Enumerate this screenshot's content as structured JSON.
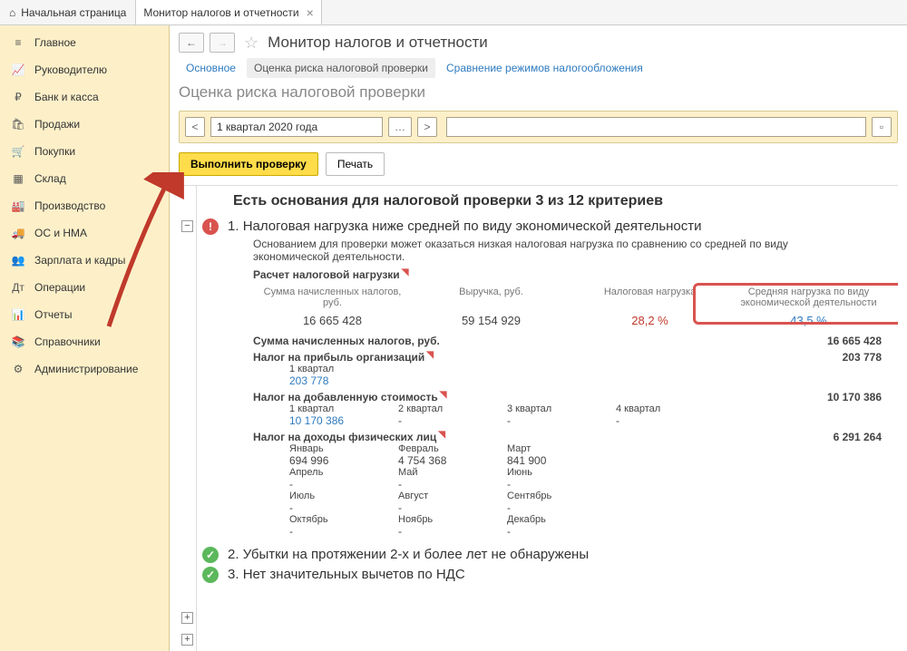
{
  "topbar": {
    "home": "Начальная страница",
    "tab": "Монитор налогов и отчетности"
  },
  "sidebar": {
    "items": [
      "Главное",
      "Руководителю",
      "Банк и касса",
      "Продажи",
      "Покупки",
      "Склад",
      "Производство",
      "ОС и НМА",
      "Зарплата и кадры",
      "Операции",
      "Отчеты",
      "Справочники",
      "Администрирование"
    ]
  },
  "header": {
    "title": "Монитор налогов и отчетности",
    "subtabs": [
      "Основное",
      "Оценка риска налоговой проверки",
      "Сравнение режимов налогообложения"
    ],
    "section": "Оценка риска налоговой проверки"
  },
  "toolbar": {
    "period": "1 квартал 2020 года",
    "run": "Выполнить проверку",
    "print": "Печать"
  },
  "report": {
    "heading": "Есть основания для налоговой проверки 3 из 12 критериев",
    "crit1": {
      "num": "1.",
      "title": "Налоговая нагрузка ниже средней по виду экономической деятельности",
      "desc": "Основанием для проверки может оказаться низкая налоговая нагрузка по сравнению со средней по виду экономической деятельности.",
      "calc_head": "Расчет налоговой нагрузки",
      "cols": [
        "Сумма начисленных налогов, руб.",
        "Выручка, руб.",
        "Налоговая нагрузка",
        "Средняя нагрузка по виду экономической деятельности"
      ],
      "vals": [
        "16 665 428",
        "59 154 929",
        "28,2 %",
        "43,5 %"
      ],
      "sum_label": "Сумма начисленных налогов, руб.",
      "sum_val": "16 665 428",
      "profit_tax": "Налог на прибыль организаций",
      "profit_val": "203 778",
      "q1": "1 квартал",
      "q1v": "203 778",
      "vat": "Налог на добавленную стоимость",
      "vat_val": "10 170 386",
      "quarters": [
        "1 квартал",
        "2 квартал",
        "3 квартал",
        "4 квартал"
      ],
      "vat_qv": [
        "10 170 386",
        "-",
        "-",
        "-"
      ],
      "pit": "Налог на доходы физических лиц",
      "pit_val": "6 291 264",
      "months1": [
        "Январь",
        "Февраль",
        "Март"
      ],
      "months1v": [
        "694 996",
        "4 754 368",
        "841 900"
      ],
      "months2": [
        "Апрель",
        "Май",
        "Июнь"
      ],
      "months3": [
        "Июль",
        "Август",
        "Сентябрь"
      ],
      "months4": [
        "Октябрь",
        "Ноябрь",
        "Декабрь"
      ]
    },
    "crit2": {
      "num": "2.",
      "title": "Убытки на протяжении 2-х и более лет не обнаружены"
    },
    "crit3": {
      "num": "3.",
      "title": "Нет значительных вычетов по НДС"
    }
  }
}
